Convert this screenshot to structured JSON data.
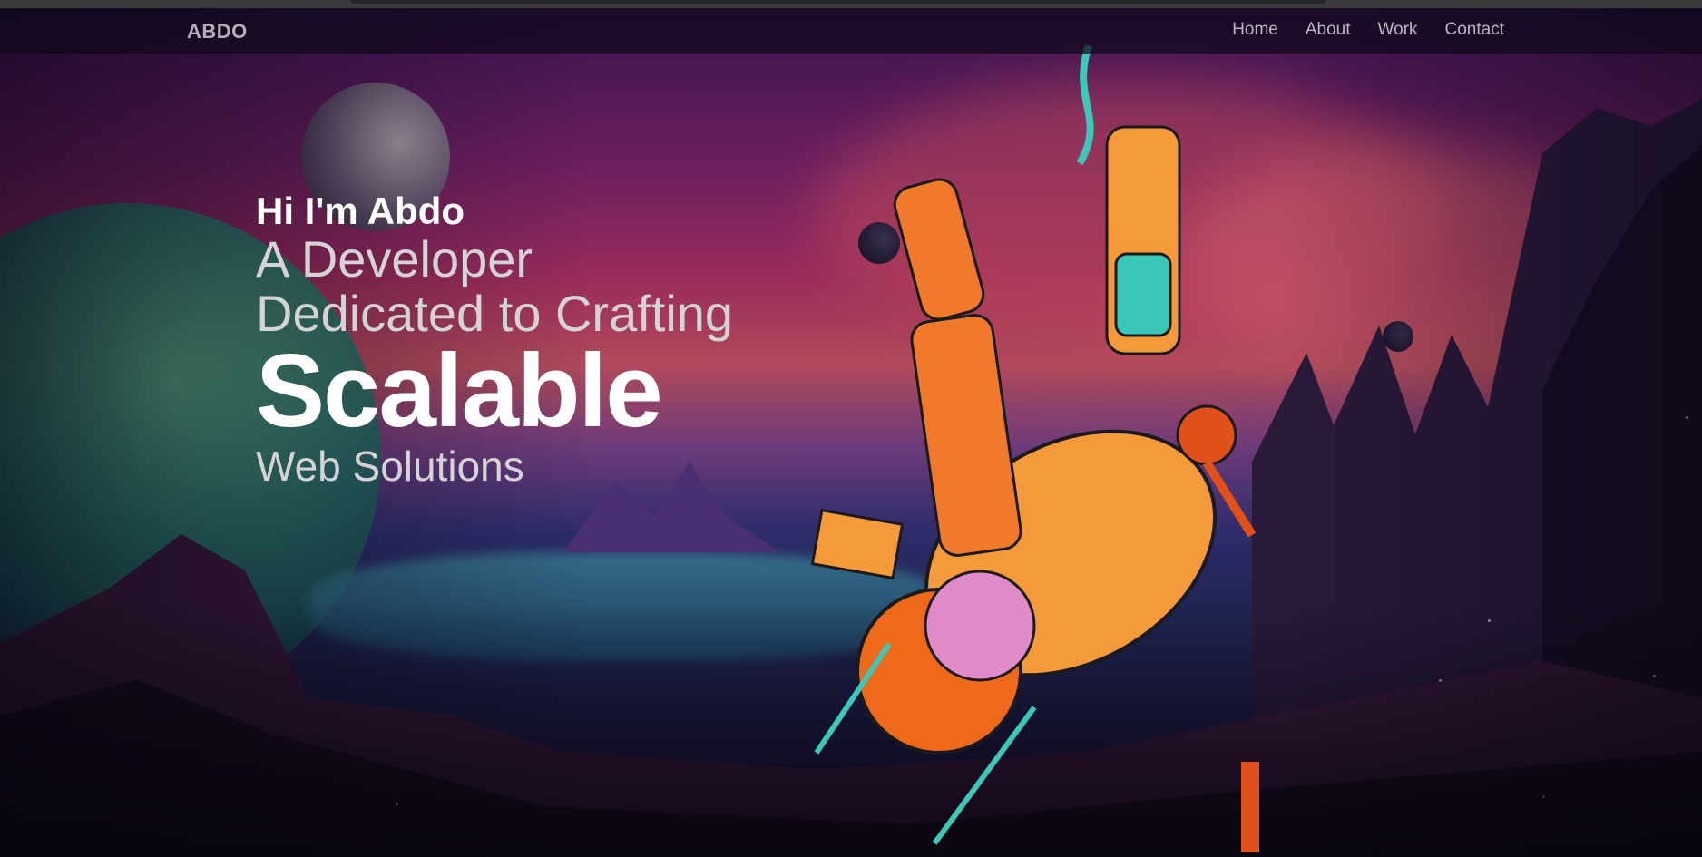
{
  "nav": {
    "logo": "ABDO",
    "links": [
      "Home",
      "About",
      "Work",
      "Contact"
    ]
  },
  "hero": {
    "greeting": "Hi I'm Abdo",
    "line1": "A Developer",
    "line2": "Dedicated to Crafting",
    "highlight": "Scalable",
    "line3": "Web Solutions"
  },
  "colors": {
    "accent_orange": "#f07a2a",
    "accent_teal": "#3cc8b8",
    "sky": "#9a2c5c"
  }
}
